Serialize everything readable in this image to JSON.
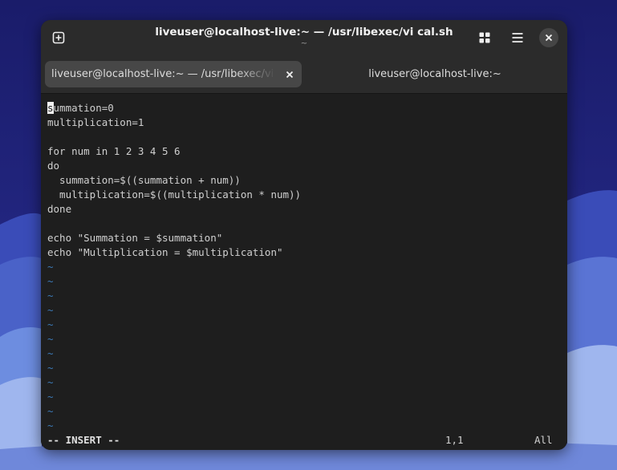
{
  "window": {
    "title": "liveuser@localhost-live:~ — /usr/libexec/vi cal.sh",
    "subtitle": "~"
  },
  "tabs": [
    {
      "label": "liveuser@localhost-live:~ — /usr/libexec/vi cal.sh",
      "active": true
    },
    {
      "label": "liveuser@localhost-live:~",
      "active": false
    }
  ],
  "editor": {
    "cursor_char": "s",
    "lines": [
      "ummation=0",
      "multiplication=1",
      "",
      "for num in 1 2 3 4 5 6",
      "do",
      "  summation=$((summation + num))",
      "  multiplication=$((multiplication * num))",
      "done",
      "",
      "echo \"Summation = $summation\"",
      "echo \"Multiplication = $multiplication\""
    ],
    "tilde": "~",
    "status": {
      "mode": "-- INSERT --",
      "position": "1,1",
      "scroll": "All"
    }
  },
  "icons": {
    "new_tab": "new-tab-icon",
    "grid": "grid-icon",
    "menu": "hamburger-menu-icon",
    "close": "close-icon",
    "tab_close": "tab-close-icon"
  },
  "colors": {
    "editor_bg": "#1e1e1e",
    "headerbar_bg": "#2b2b2b",
    "active_tab_bg": "#474747",
    "tilde": "#3c7ab8",
    "text": "#d0d0d0"
  }
}
